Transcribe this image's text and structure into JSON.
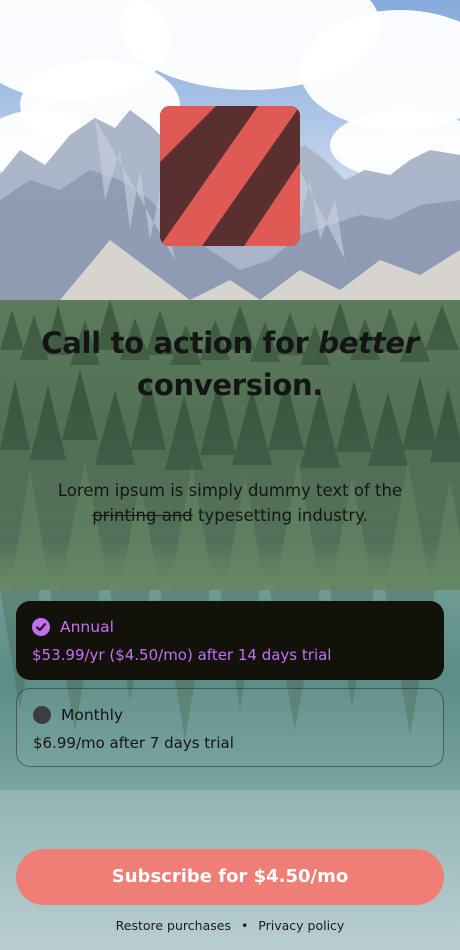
{
  "headline": {
    "part1": "Call to action for ",
    "emphasis": "better",
    "part2": " conversion."
  },
  "body_copy": {
    "part1": "Lorem ipsum is simply dummy text of the ",
    "strikethrough": "printing and",
    "part2": " typesetting industry."
  },
  "plans": [
    {
      "name": "Annual",
      "price": "$53.99/yr ($4.50/mo) after 14 days trial",
      "selected": true
    },
    {
      "name": "Monthly",
      "price": "$6.99/mo after 7 days trial",
      "selected": false
    }
  ],
  "cta": {
    "label": "Subscribe for $4.50/mo"
  },
  "footer": {
    "restore": "Restore purchases",
    "separator": "•",
    "privacy": "Privacy policy"
  },
  "colors": {
    "accent": "#c66ff2",
    "cta": "#ee7e76",
    "logo_dark": "#5a2f2f",
    "logo_stripe": "#e05a55",
    "selected_card": "#12110a"
  },
  "icons": {
    "selected_radio": "check-circle-icon",
    "unselected_radio": "empty-circle-icon"
  }
}
